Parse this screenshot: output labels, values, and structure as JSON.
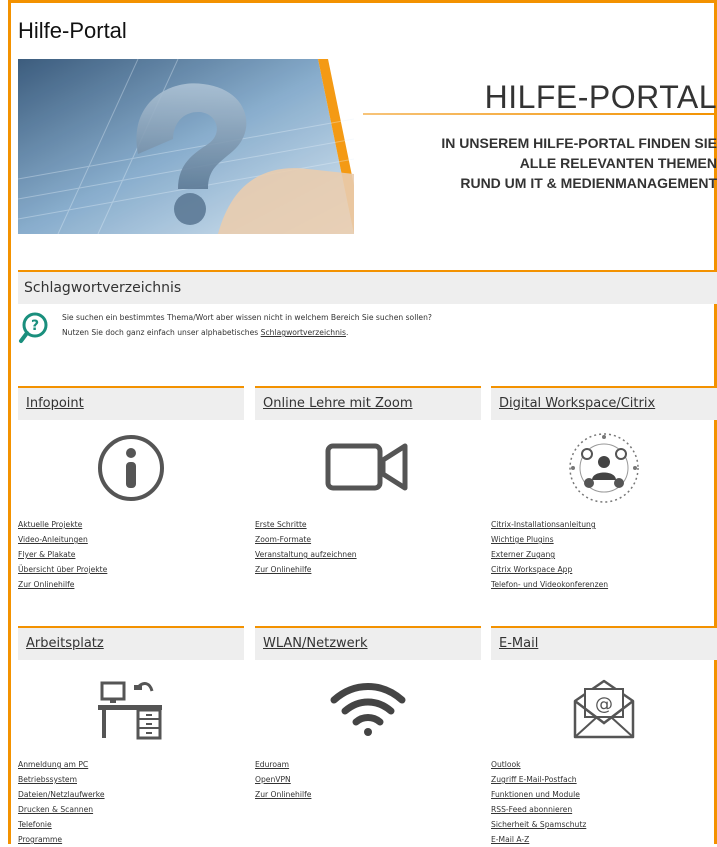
{
  "page": {
    "title": "Hilfe-Portal"
  },
  "banner": {
    "heading": "HILFE-PORTAL",
    "subline1": "IN UNSEREM HILFE-PORTAL FINDEN SIE",
    "subline2": "ALLE RELEVANTEN THEMEN",
    "subline3": "RUND UM IT & MEDIENMANAGEMENT"
  },
  "keyword": {
    "heading": "Schlagwortverzeichnis",
    "line1": "Sie suchen ein bestimmtes Thema/Wort aber wissen nicht in welchem Bereich Sie suchen sollen?",
    "line2_prefix": "Nutzen Sie doch ganz einfach unser alphabetisches",
    "line2_link": "Schlagwortverzeichnis",
    "line2_suffix": "."
  },
  "cards": [
    {
      "title": "Infopoint",
      "icon": "info-icon",
      "links": [
        "Aktuelle Projekte",
        "Video-Anleitungen",
        "Flyer & Plakate",
        "Übersicht über Projekte",
        "Zur Onlinehilfe"
      ]
    },
    {
      "title": "Online Lehre mit Zoom",
      "icon": "video-camera-icon",
      "links": [
        "Erste Schritte",
        "Zoom-Formate",
        "Veranstaltung aufzeichnen",
        "Zur Onlinehilfe"
      ]
    },
    {
      "title": "Digital Workspace/Citrix",
      "icon": "workspace-network-icon",
      "links": [
        "Citrix-Installationsanleitung",
        "Wichtige Plugins",
        "Externer Zugang",
        "Citrix Workspace App",
        "Telefon- und Videokonferenzen"
      ]
    },
    {
      "title": "Arbeitsplatz",
      "icon": "desk-computer-icon",
      "links": [
        "Anmeldung am PC",
        "Betriebssystem",
        "Dateien/Netzlaufwerke",
        "Drucken & Scannen",
        "Telefonie",
        "Programme"
      ]
    },
    {
      "title": "WLAN/Netzwerk",
      "icon": "wifi-icon",
      "links": [
        "Eduroam",
        "OpenVPN",
        "Zur Onlinehilfe"
      ]
    },
    {
      "title": "E-Mail",
      "icon": "email-icon",
      "links": [
        "Outlook",
        "Zugriff E-Mail-Postfach",
        "Funktionen und Module",
        "RSS-Feed abonnieren",
        "Sicherheit & Spamschutz",
        "E-Mail A-Z"
      ]
    }
  ],
  "colors": {
    "accent": "#f39200",
    "header_bg": "#eeeeee",
    "icon_gray": "#555555",
    "teal": "#1a8f7d"
  }
}
